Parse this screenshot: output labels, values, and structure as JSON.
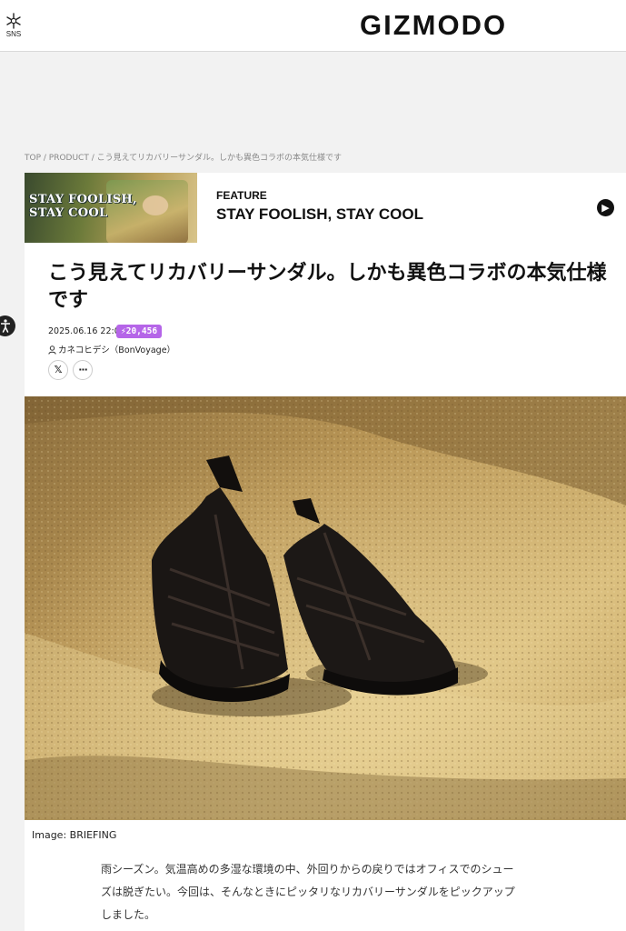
{
  "header": {
    "sns_label": "SNS",
    "logo": "GIZMODO"
  },
  "breadcrumb": "TOP / PRODUCT / こう見えてリカバリーサンダル。しかも異色コラボの本気仕様です",
  "feature": {
    "thumb_text_line1": "STAY FOOLISH,",
    "thumb_text_line2": "STAY COOL",
    "kicker": "FEATURE",
    "title": "STAY FOOLISH, STAY COOL",
    "next_icon": "chevron-right-icon"
  },
  "article": {
    "title": "こう見えてリカバリーサンダル。しかも異色コラボの本気仕様です",
    "date": "2025.06.16 22:00",
    "views": "⚡20,456",
    "author": "カネコヒデシ（BonVoyage）",
    "share_x": "𝕏",
    "share_more": "···",
    "image_caption": "Image: BRIEFING",
    "body": "雨シーズン。気温高めの多湿な環境の中、外回りからの戻りではオフィスでのシューズは脱ぎたい。今回は、そんなときにピッタリなリカバリーサンダルをピックアップしました。"
  },
  "colors": {
    "views_badge": "#b565e8",
    "background": "#f2f2f2"
  }
}
